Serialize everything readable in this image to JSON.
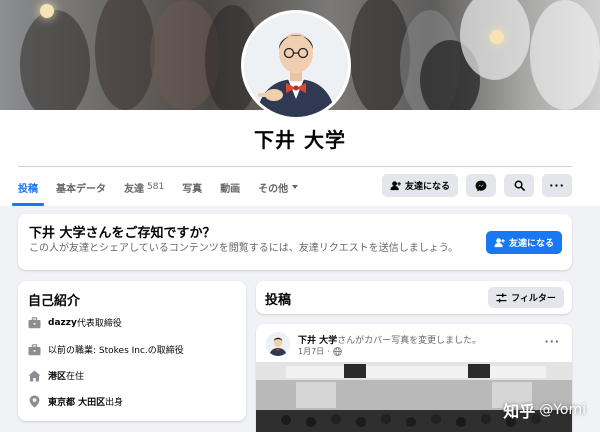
{
  "profile": {
    "name": "下井 大学"
  },
  "tabs": [
    {
      "label": "投稿",
      "active": true
    },
    {
      "label": "基本データ"
    },
    {
      "label": "友達",
      "count": "581"
    },
    {
      "label": "写真"
    },
    {
      "label": "動画"
    },
    {
      "label": "その他"
    }
  ],
  "actions": {
    "add_friend": "友達になる",
    "messenger_icon": "messenger-icon",
    "search_icon": "search-icon",
    "more": "···"
  },
  "know_card": {
    "title": "下井 大学さんをご存知ですか？",
    "description": "この人が友達とシェアしているコンテンツを閲覧するには、友達リクエストを送信しましょう。",
    "button": "友達になる"
  },
  "intro": {
    "title": "自己紹介",
    "rows": [
      {
        "icon": "briefcase-icon",
        "bold": "dazzy",
        "text": " 代表取締役"
      },
      {
        "icon": "briefcase-icon",
        "bold": "",
        "text": "以前の職業: Stokes Inc.の取締役"
      },
      {
        "icon": "home-icon",
        "bold": "港区",
        "text": "在住"
      },
      {
        "icon": "location-pin-icon",
        "bold": "東京都 大田区",
        "text": "出身"
      }
    ]
  },
  "posts": {
    "title": "投稿",
    "filter": "フィルター"
  },
  "post": {
    "author": "下井 大学",
    "action": "さんがカバー写真を変更しました。",
    "date": "1月7日",
    "more": "···"
  },
  "watermark": {
    "brand": "知乎",
    "handle": "@Yomi"
  },
  "colors": {
    "accent": "#1877f2",
    "background": "#f0f2f5",
    "secondary_text": "#65676b"
  }
}
